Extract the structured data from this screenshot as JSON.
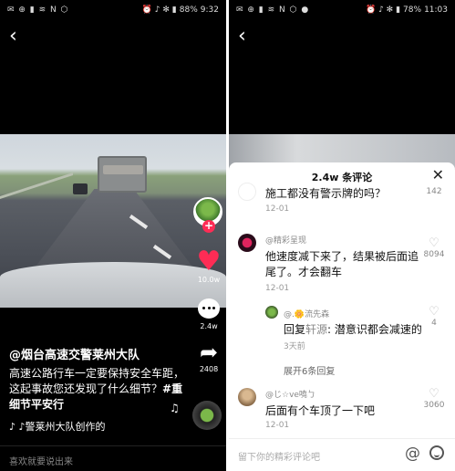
{
  "left": {
    "status": {
      "icons_left": "✉ ⊕ ▮ ≋ N ⬡",
      "icons_right": "⏰ ♪ ✻ ▮",
      "battery": "88%",
      "time": "9:32"
    },
    "author": "@烟台高速交警莱州大队",
    "description": "高速公路行车一定要保持安全车距，这起事故您还发现了什么细节？",
    "hashtag": "#重细节平安行",
    "music": "♪ ♪警莱州大队创作的",
    "likes": "10.0w",
    "comments": "2.4w",
    "shares": "2408",
    "input_placeholder": "喜欢就要说出来"
  },
  "right": {
    "status": {
      "icons_left": "✉ ⊕ ▮ ≋ N ⬡ ●",
      "icons_right": "⏰ ♪ ✻ ▮",
      "battery": "78%",
      "time": "11:03"
    },
    "sheet_title": "2.4w 条评论",
    "comments": [
      {
        "text": "施工都没有警示牌的吗？",
        "date": "12-01",
        "likes": "142"
      },
      {
        "name": "@精彩呈现",
        "text": "他速度减下来了，结果被后面追尾了。才会翻车",
        "date": "12-01",
        "likes": "8094"
      },
      {
        "name": "@.🌼流先森",
        "text_prefix": "回复",
        "reply_to": "轩源",
        "text": ": 潜意识都会减速的",
        "ago": "3天前",
        "likes": "4"
      },
      {
        "name": "@じ☆ve嘵ㄅ",
        "text": "后面有个车顶了一下吧",
        "date": "12-01",
        "likes": "3060"
      }
    ],
    "expand_label": "展开6条回复",
    "input_placeholder": "留下你的精彩评论吧"
  }
}
